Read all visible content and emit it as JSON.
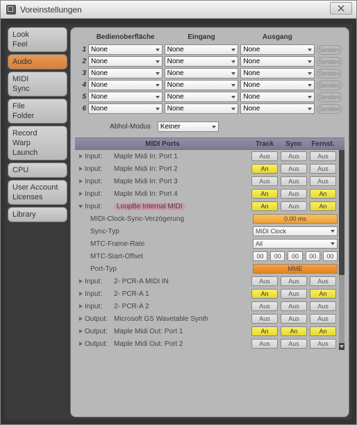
{
  "title": "Voreinstellungen",
  "sidebar": [
    {
      "items": [
        "Look",
        "Feel"
      ],
      "active": false
    },
    {
      "items": [
        "Audio"
      ],
      "active": true
    },
    {
      "items": [
        "MIDI",
        "Sync"
      ],
      "active": false
    },
    {
      "items": [
        "File",
        "Folder"
      ],
      "active": false
    },
    {
      "items": [
        "Record",
        "Warp",
        "Launch"
      ],
      "active": false
    },
    {
      "items": [
        "CPU"
      ],
      "active": false
    },
    {
      "items": [
        "User Account",
        "Licenses"
      ],
      "active": false
    },
    {
      "items": [
        "Library"
      ],
      "active": false
    }
  ],
  "ctrl_headers": {
    "surface": "Bedienoberfläche",
    "input": "Eingang",
    "output": "Ausgang",
    "send": "Senden"
  },
  "ctrl_rows": [
    {
      "n": "1",
      "s": "None",
      "i": "None",
      "o": "None"
    },
    {
      "n": "2",
      "s": "None",
      "i": "None",
      "o": "None"
    },
    {
      "n": "3",
      "s": "None",
      "i": "None",
      "o": "None"
    },
    {
      "n": "4",
      "s": "None",
      "i": "None",
      "o": "None"
    },
    {
      "n": "5",
      "s": "None",
      "i": "None",
      "o": "None"
    },
    {
      "n": "6",
      "s": "None",
      "i": "None",
      "o": "None"
    }
  ],
  "abhol": {
    "label": "Abhol-Modus",
    "value": "Keiner"
  },
  "port_headers": {
    "ports": "MIDI Ports",
    "track": "Track",
    "sync": "Sync",
    "remote": "Fernst."
  },
  "toggles": {
    "on": "An",
    "off": "Aus"
  },
  "ports": [
    {
      "exp": "r",
      "dir": "Input:",
      "name": "Maple Midi In: Port 1",
      "t": "off",
      "s": "off",
      "r": "off"
    },
    {
      "exp": "r",
      "dir": "Input:",
      "name": "Maple Midi In: Port 2",
      "t": "on",
      "s": "off",
      "r": "off"
    },
    {
      "exp": "r",
      "dir": "Input:",
      "name": "Maple Midi In: Port 3",
      "t": "off",
      "s": "off",
      "r": "off"
    },
    {
      "exp": "r",
      "dir": "Input:",
      "name": "Maple Midi In: Port 4",
      "t": "on",
      "s": "off",
      "r": "on"
    },
    {
      "exp": "d",
      "dir": "Input:",
      "name": "LoopBe Internal MIDI",
      "t": "on",
      "s": "off",
      "r": "on",
      "hl": true
    },
    {
      "exp": "r",
      "dir": "Input:",
      "name": "2- PCR-A MIDI IN",
      "t": "off",
      "s": "off",
      "r": "off"
    },
    {
      "exp": "r",
      "dir": "Input:",
      "name": "2- PCR-A 1",
      "t": "on",
      "s": "off",
      "r": "on"
    },
    {
      "exp": "r",
      "dir": "Input:",
      "name": "2- PCR-A 2",
      "t": "off",
      "s": "off",
      "r": "off"
    },
    {
      "exp": "r",
      "dir": "Output:",
      "name": "Microsoft GS Wavetable Synth",
      "t": "off",
      "s": "off",
      "r": "off"
    },
    {
      "exp": "r",
      "dir": "Output:",
      "name": "Maple Midi Out: Port 1",
      "t": "on",
      "s": "on",
      "r": "on"
    },
    {
      "exp": "r",
      "dir": "Output:",
      "name": "Maple Midi Out: Port 2",
      "t": "off",
      "s": "off",
      "r": "off"
    }
  ],
  "sub": {
    "delay_label": "MIDI-Clock-Sync-Verzögerung",
    "delay_value": "0.00 ms",
    "synctype_label": "Sync-Typ",
    "synctype_value": "MIDI Clock",
    "mtcrate_label": "MTC-Frame-Rate",
    "mtcrate_value": "All",
    "mtcoffset_label": "MTC-Start-Offset",
    "mtc_seg": [
      "00",
      "00",
      "00",
      "00",
      "00"
    ],
    "porttype_label": "Port-Typ",
    "porttype_value": "MME"
  }
}
